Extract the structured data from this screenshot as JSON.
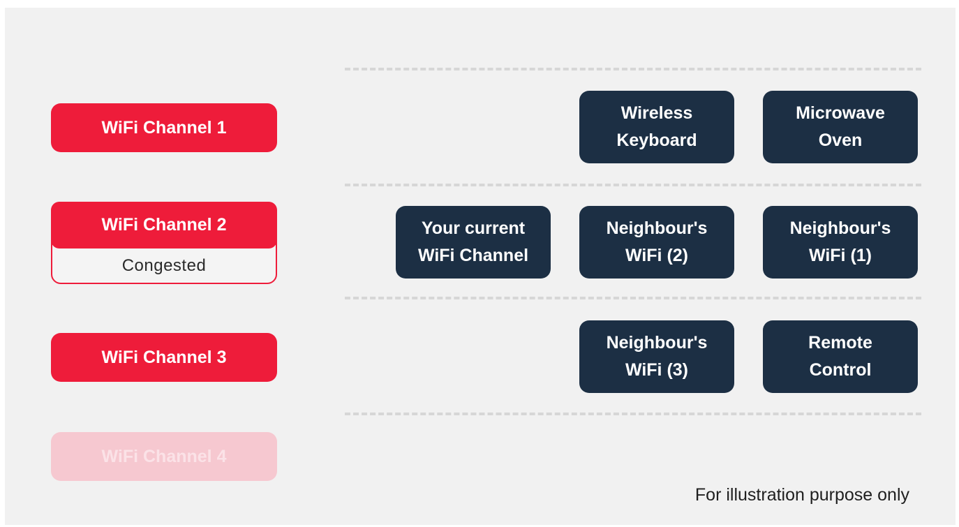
{
  "channels": [
    {
      "label": "WiFi Channel 1",
      "status": ""
    },
    {
      "label": "WiFi Channel 2",
      "status": "Congested"
    },
    {
      "label": "WiFi Channel 3",
      "status": ""
    },
    {
      "label": "WiFi Channel 4",
      "status": ""
    }
  ],
  "devices": {
    "wireless_keyboard": [
      "Wireless",
      "Keyboard"
    ],
    "microwave_oven": [
      "Microwave",
      "Oven"
    ],
    "your_current_channel": [
      "Your current",
      "WiFi Channel"
    ],
    "neighbours_wifi_2": [
      "Neighbour's",
      "WiFi (2)"
    ],
    "neighbours_wifi_1": [
      "Neighbour's",
      "WiFi (1)"
    ],
    "neighbours_wifi_3": [
      "Neighbour's",
      "WiFi (3)"
    ],
    "remote_control": [
      "Remote",
      "Control"
    ]
  },
  "footnote": "For illustration purpose only",
  "colors": {
    "channel_red": "#ee1c3a",
    "channel_faded": "#f6c8d0",
    "device_navy": "#1c2f44",
    "background": "#f1f1f1"
  }
}
